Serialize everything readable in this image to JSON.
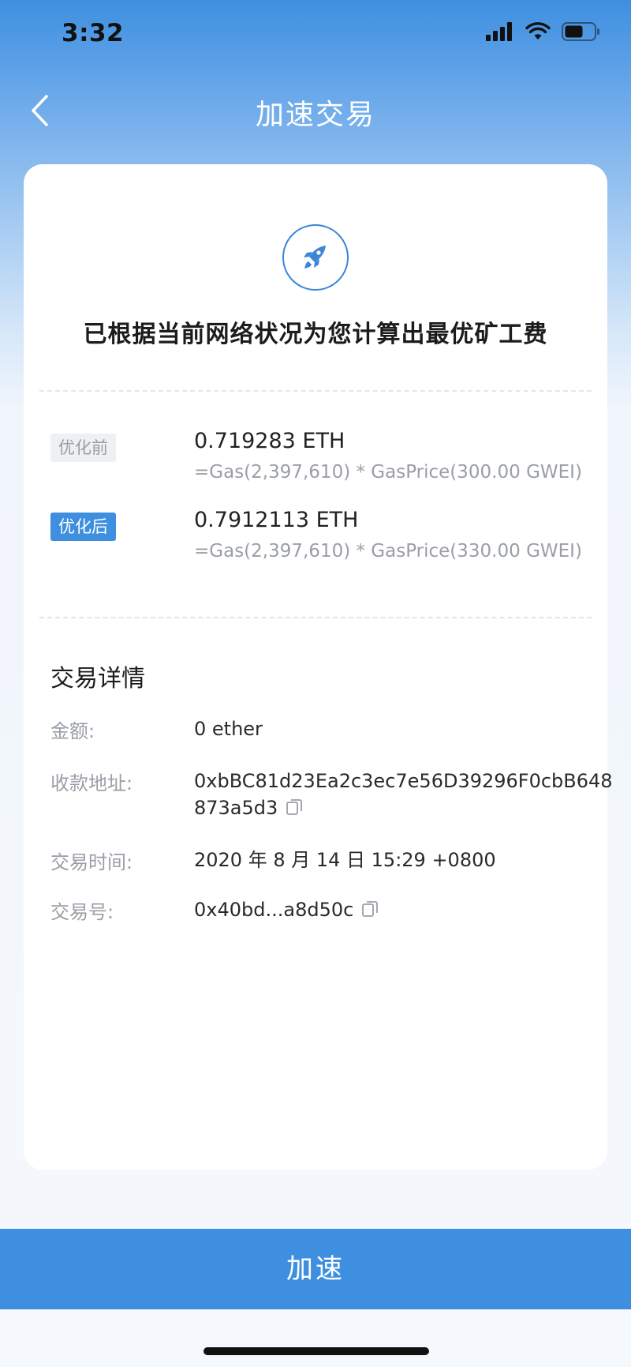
{
  "status_bar": {
    "time": "3:32",
    "icons": [
      "signal-icon",
      "wifi-icon",
      "battery-icon"
    ]
  },
  "nav": {
    "title": "加速交易",
    "back_icon": "chevron-left-icon"
  },
  "hero": {
    "icon": "rocket-icon",
    "headline": "已根据当前网络状况为您计算出最优矿工费"
  },
  "fees": [
    {
      "tag": "优化前",
      "amount": "0.719283 ETH",
      "formula": "=Gas(2,397,610) * GasPrice(300.00 GWEI)"
    },
    {
      "tag": "优化后",
      "amount": "0.7912113 ETH",
      "formula": "=Gas(2,397,610) * GasPrice(330.00 GWEI)"
    }
  ],
  "details": {
    "title": "交易详情",
    "amount_label": "金额:",
    "amount_value": "0 ether",
    "recipient_label": "收款地址:",
    "recipient_value": "0xbBC81d23Ea2c3ec7e56D39296F0cbB648873a5d3",
    "time_label": "交易时间:",
    "time_value": "2020 年 8 月 14 日 15:29 +0800",
    "tx_label": "交易号:",
    "tx_value": "0x40bd...a8d50c"
  },
  "action": {
    "label": "加速"
  },
  "colors": {
    "primary": "#3e8fe0",
    "muted_text": "#9a9ea6",
    "card": "#ffffff"
  }
}
